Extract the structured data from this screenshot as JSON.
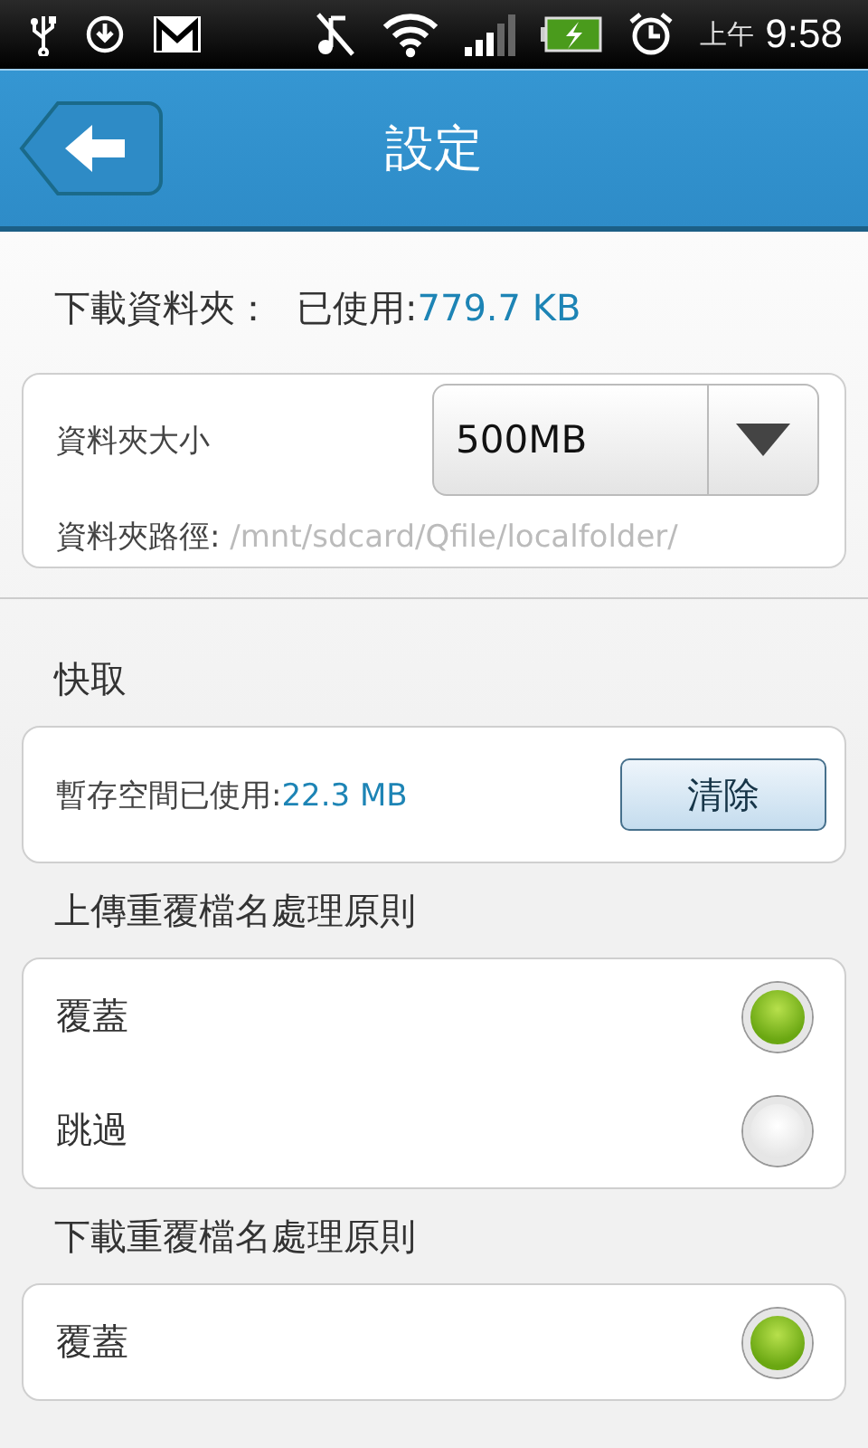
{
  "status_bar": {
    "am_pm": "上午",
    "time": "9:58"
  },
  "header": {
    "title": "設定"
  },
  "download_folder": {
    "label": "下載資料夾：",
    "used_label": "已使用:",
    "used_value": "779.7 KB",
    "size_label": "資料夾大小",
    "size_value": "500MB",
    "path_label": "資料夾路徑:",
    "path_value": "/mnt/sdcard/Qfile/localfolder/"
  },
  "cache": {
    "heading": "快取",
    "used_label": "暫存空間已使用:",
    "used_value": "22.3 MB",
    "button": "清除"
  },
  "upload_policy": {
    "heading": "上傳重覆檔名處理原則",
    "options": [
      {
        "label": "覆蓋",
        "selected": true
      },
      {
        "label": "跳過",
        "selected": false
      }
    ]
  },
  "download_policy": {
    "heading": "下載重覆檔名處理原則",
    "options": [
      {
        "label": "覆蓋",
        "selected": true
      }
    ]
  }
}
